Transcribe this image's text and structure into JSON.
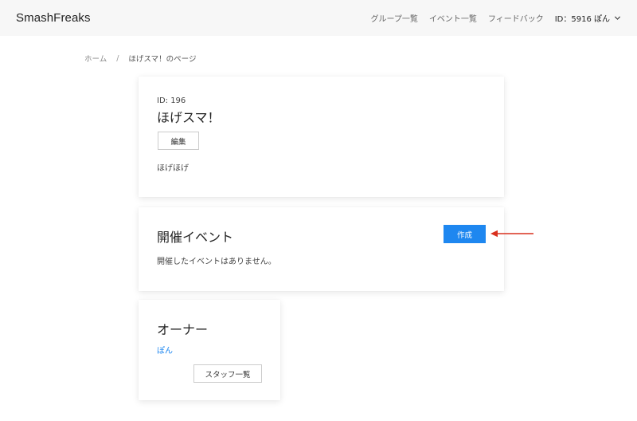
{
  "header": {
    "brand": "SmashFreaks",
    "nav": {
      "groups": "グループ一覧",
      "events": "イベント一覧",
      "feedback": "フィードバック",
      "user": "ID：5916 ぽん"
    }
  },
  "breadcrumb": {
    "home": "ホーム",
    "separator": "/",
    "current": "ほげスマ！のページ"
  },
  "group": {
    "id_label": "ID: 196",
    "name": "ほげスマ！",
    "edit_label": "編集",
    "description": "ほげほげ"
  },
  "events": {
    "title": "開催イベント",
    "create_label": "作成",
    "empty_message": "開催したイベントはありません。"
  },
  "owner": {
    "title": "オーナー",
    "name": "ぽん",
    "staff_label": "スタッフ一覧"
  },
  "colors": {
    "primary": "#1e87f0",
    "annotation_arrow": "#d9301e",
    "navbar_bg": "#f7f7f7"
  },
  "icons": {
    "user_menu": "chevron-down-icon",
    "annotation": "arrow-left-icon"
  }
}
